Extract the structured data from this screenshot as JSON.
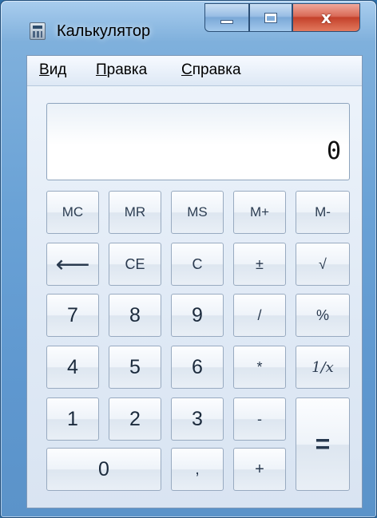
{
  "window": {
    "title": "Калькулятор",
    "close_glyph": "x",
    "icons": {
      "app": "calculator-icon",
      "minimize": "minimize-icon",
      "maximize": "maximize-icon",
      "close": "close-icon"
    }
  },
  "menu": {
    "items": [
      {
        "label": "Вид",
        "accel": "В",
        "rest": "ид"
      },
      {
        "label": "Правка",
        "accel": "П",
        "rest": "равка"
      },
      {
        "label": "Справка",
        "accel": "С",
        "rest": "правка"
      }
    ]
  },
  "display": {
    "value": "0"
  },
  "keys": {
    "mc": "MC",
    "mr": "MR",
    "ms": "MS",
    "mplus": "M+",
    "mminus": "M-",
    "backspace": "⟵",
    "ce": "CE",
    "c": "C",
    "plusminus": "±",
    "sqrt": "√",
    "d7": "7",
    "d8": "8",
    "d9": "9",
    "divide": "/",
    "percent": "%",
    "d4": "4",
    "d5": "5",
    "d6": "6",
    "multiply": "*",
    "reciprocal": "1/x",
    "d1": "1",
    "d2": "2",
    "d3": "3",
    "minus": "-",
    "equals": "=",
    "d0": "0",
    "decimal": ",",
    "plus": "+"
  },
  "colors": {
    "frame": "#6aa2d6",
    "close_button": "#c4412b",
    "client_bg": "#dfe9f5",
    "key_border": "#98aac0"
  }
}
